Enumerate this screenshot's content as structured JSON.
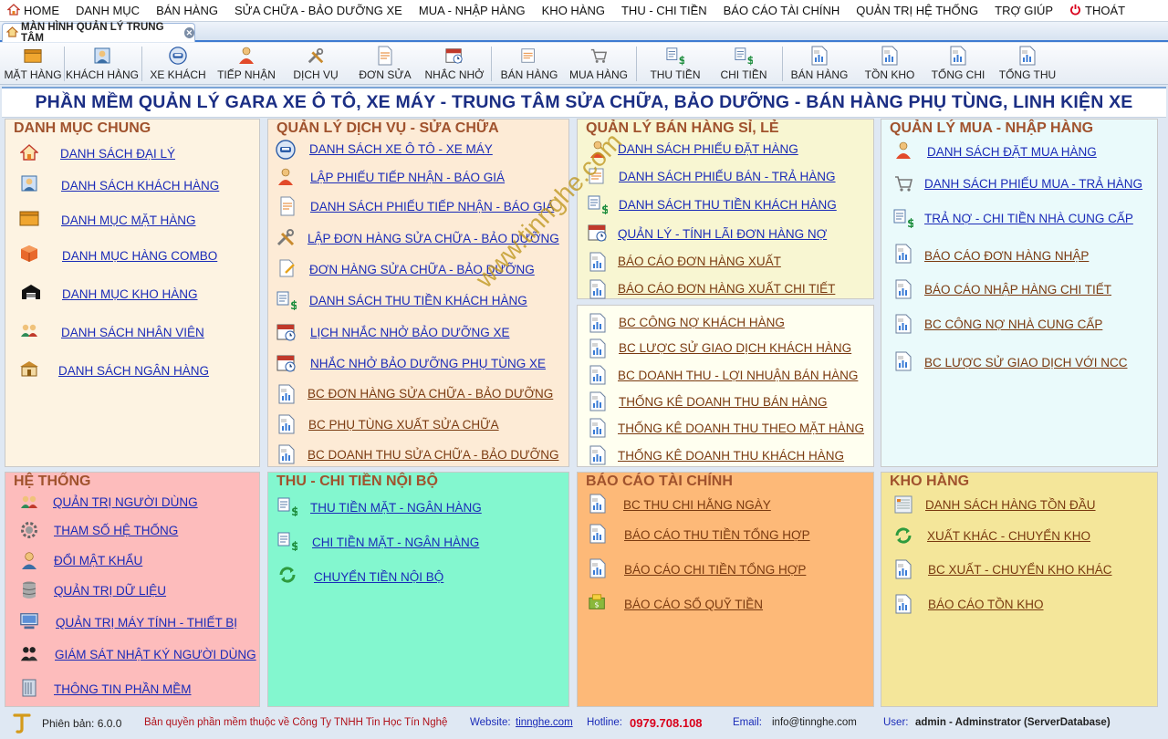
{
  "menu": {
    "home": "HOME",
    "danh_muc": "DANH MỤC",
    "ban_hang": "BÁN HÀNG",
    "sua_chua": "SỬA CHỮA - BẢO DƯỠNG XE",
    "mua_nhap": "MUA - NHẬP HÀNG",
    "kho_hang": "KHO HÀNG",
    "thu_chi": "THU - CHI TIỀN",
    "bao_cao": "BÁO CÁO TÀI CHÍNH",
    "quan_tri": "QUẢN TRỊ HỆ THỐNG",
    "tro_giup": "TRỢ GIÚP",
    "thoat": "THOÁT"
  },
  "tab": {
    "label": "MÀN HÌNH QUẢN LÝ TRUNG TÂM"
  },
  "toolbar": [
    "MẶT HÀNG",
    "KHÁCH HÀNG",
    "XE KHÁCH",
    "TIẾP NHẬN",
    "DỊCH VỤ",
    "ĐƠN SỬA",
    "NHẮC NHỞ",
    "BÁN HÀNG",
    "MUA HÀNG",
    "THU TIỀN",
    "CHI TIỀN",
    "BÁN HÀNG",
    "TỒN KHO",
    "TỔNG CHI",
    "TỔNG THU"
  ],
  "banner": "PHẦN MỀM QUẢN LÝ GARA XE Ô TÔ, XE MÁY - TRUNG TÂM SỬA CHỮA, BẢO DƯỠNG - BÁN HÀNG PHỤ TÙNG, LINH KIỆN XE",
  "panels": {
    "danh_muc": {
      "title": "DANH MỤC CHUNG",
      "items": [
        "DANH SÁCH ĐẠI LÝ",
        "DANH SÁCH KHÁCH HÀNG",
        "DANH MỤC MẶT HÀNG",
        "DANH MỤC HÀNG COMBO",
        "DANH MỤC KHO HÀNG",
        "DANH SÁCH NHÂN VIÊN",
        "DANH SÁCH NGÂN HÀNG"
      ]
    },
    "dich_vu": {
      "title": "QUẢN LÝ DỊCH VỤ -  SỬA CHỮA",
      "items": [
        "DANH SÁCH XE Ô TÔ - XE MÁY",
        "LẬP PHIẾU TIẾP NHẬN - BÁO GIÁ",
        "DANH SÁCH PHIẾU TIẾP NHẬN - BÁO GIÁ",
        "LẬP ĐƠN HÀNG SỬA CHỮA - BẢO DƯỠNG",
        "ĐƠN HÀNG SỬA CHỮA - BẢO DƯỠNG",
        "DANH SÁCH THU TIỀN KHÁCH HÀNG",
        "LỊCH NHẮC NHỞ BẢO DƯỠNG XE",
        "NHẮC NHỞ BẢO DƯỠNG PHỤ TÙNG XE",
        "BC ĐƠN HÀNG SỬA CHỮA - BẢO DƯỠNG",
        "BC PHỤ TÙNG XUẤT SỬA CHỮA",
        "BC DOANH THU SỬA CHỮA - BẢO DƯỠNG"
      ]
    },
    "ban_hang": {
      "title": "QUẢN LÝ BÁN HÀNG SỈ, LẺ",
      "items": [
        "DANH SÁCH PHIẾU ĐẶT HÀNG",
        "DANH SÁCH PHIẾU BÁN - TRẢ HÀNG",
        "DANH SÁCH THU TIỀN KHÁCH HÀNG",
        "QUẢN LÝ - TÍNH LÃI ĐƠN HÀNG NỢ",
        "BÁO CÁO ĐƠN HÀNG XUẤT",
        "BÁO CÁO ĐƠN HÀNG XUẤT CHI TIẾT"
      ],
      "reports": [
        "BC CÔNG NỢ KHÁCH HÀNG",
        "BC LƯỢC SỬ GIAO DỊCH KHÁCH HÀNG",
        "BC DOANH THU - LỢI NHUẬN BÁN HÀNG",
        "THỐNG KÊ DOANH THU BÁN HÀNG",
        "THỐNG KÊ DOANH THU THEO MẶT HÀNG",
        "THỐNG KÊ DOANH THU KHÁCH HÀNG"
      ]
    },
    "mua_nhap": {
      "title": "QUẢN LÝ MUA - NHẬP HÀNG",
      "items": [
        "DANH SÁCH ĐẶT MUA HÀNG",
        "DANH SÁCH PHIẾU MUA - TRẢ HÀNG",
        "TRẢ NỢ - CHI TIỀN NHÀ CUNG CẤP",
        "BÁO CÁO ĐƠN HÀNG NHẬP",
        "BÁO CÁO NHẬP HÀNG CHI TIẾT",
        "BC CÔNG NỢ NHÀ CUNG CẤP",
        "BC LƯỢC SỬ GIAO DỊCH VỚI NCC"
      ]
    },
    "he_thong": {
      "title": "HỆ THỐNG",
      "items": [
        "QUẢN TRỊ NGƯỜI DÙNG",
        "THAM SỐ HỆ THỐNG",
        "ĐỔI MẬT KHẨU",
        "QUẢN TRỊ DỮ LIỆU",
        "QUẢN TRỊ MÁY TÍNH - THIẾT BỊ",
        "GIÁM SÁT NHẬT KÝ NGƯỜI DÙNG",
        "THÔNG TIN PHẦN MỀM"
      ]
    },
    "thu_chi": {
      "title": "THU - CHI TIỀN NỘI BỘ",
      "items": [
        "THU TIỀN MẶT - NGÂN HÀNG",
        "CHI TIỀN MẶT - NGÂN HÀNG",
        "CHUYỂN TIỀN NỘI BỘ"
      ]
    },
    "tai_chinh": {
      "title": "BÁO CÁO TÀI CHÍNH",
      "items": [
        "BC THU CHI HẰNG NGÀY",
        "BÁO CÁO THU TIỀN TỔNG HỢP",
        "BÁO CÁO CHI TIỀN TỔNG HỢP",
        "BÁO CÁO SỔ QUỸ TIỀN"
      ]
    },
    "kho_hang": {
      "title": "KHO HÀNG",
      "items": [
        "DANH SÁCH HÀNG TỒN ĐẦU",
        "XUẤT KHÁC - CHUYỂN KHO",
        "BC XUẤT - CHUYỂN KHO KHÁC",
        "BÁO CÁO TỒN KHO"
      ]
    }
  },
  "status": {
    "version_label": "Phiên bản: 6.0.0",
    "copyright": "Bản quyền phần mềm thuộc về Công Ty TNHH Tin Học Tín Nghệ",
    "website_label": "Website:",
    "website": "tinnghe.com",
    "hotline_label": "Hotline:",
    "hotline": "0979.708.108",
    "email_label": "Email:",
    "email": "info@tinnghe.com",
    "user_label": "User:",
    "user": "admin - Adminstrator (ServerDatabase)"
  },
  "watermark": "www.tinnghe.com",
  "colors": {
    "danh_muc": "#fdf3e2",
    "dich_vu": "#fdebd6",
    "ban_hang": "#f8f6d2",
    "ban_hang_reports": "#fffff0",
    "mua_nhap": "#eafafb",
    "he_thong": "#fdbcbc",
    "thu_chi": "#83f7cf",
    "tai_chinh": "#fdb978",
    "kho_hang": "#f4e69a",
    "title": "#a0522d",
    "banner": "#1b2e84"
  }
}
